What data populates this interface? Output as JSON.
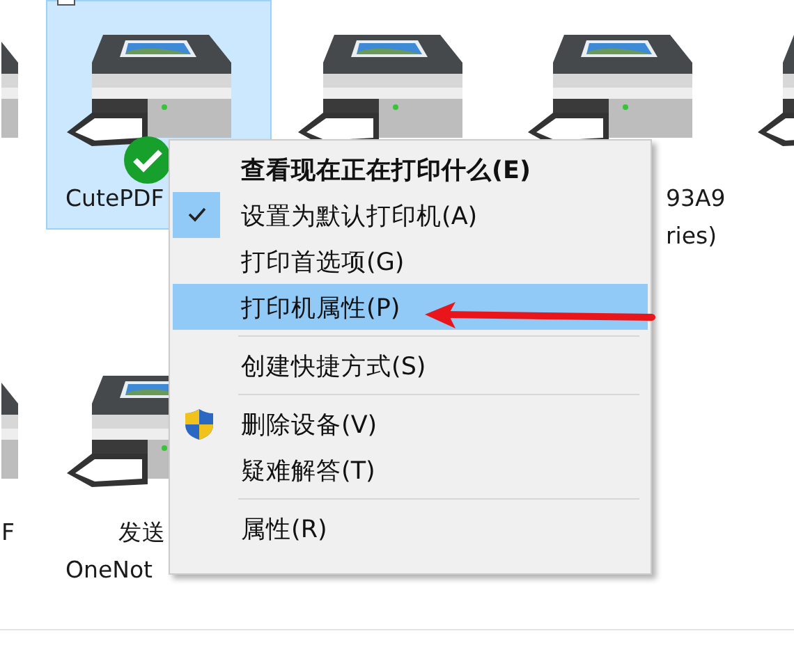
{
  "devices": [
    {
      "selected": false
    },
    {
      "labels": [
        "CutePDF"
      ],
      "selected": true,
      "default": true,
      "checkbox": {
        "checked": false
      }
    },
    {
      "selected": false,
      "default": false
    },
    {
      "labels": [
        "93A9",
        "ries)"
      ],
      "selected": false,
      "default": false
    },
    {
      "selected": false
    },
    {
      "labels": [
        "F"
      ],
      "selected": false
    },
    {
      "labels": [
        "发送",
        "OneNot"
      ],
      "selected": false,
      "default": false
    }
  ],
  "context_menu": {
    "items": [
      {
        "kind": "item",
        "label": "查看现在正在打印什么(E)",
        "default": true,
        "checked": false,
        "selected": false,
        "elevated": false
      },
      {
        "kind": "item",
        "label": "设置为默认打印机(A)",
        "default": false,
        "checked": true,
        "selected": false,
        "elevated": false
      },
      {
        "kind": "item",
        "label": "打印首选项(G)",
        "default": false,
        "checked": false,
        "selected": false,
        "elevated": false
      },
      {
        "kind": "item",
        "label": "打印机属性(P)",
        "default": false,
        "checked": false,
        "selected": true,
        "elevated": false
      },
      {
        "kind": "separator"
      },
      {
        "kind": "item",
        "label": "创建快捷方式(S)",
        "default": false,
        "checked": false,
        "selected": false,
        "elevated": false
      },
      {
        "kind": "separator"
      },
      {
        "kind": "item",
        "label": "删除设备(V)",
        "default": false,
        "checked": false,
        "selected": false,
        "elevated": true
      },
      {
        "kind": "item",
        "label": "疑难解答(T)",
        "default": false,
        "checked": false,
        "selected": false,
        "elevated": false
      },
      {
        "kind": "separator"
      },
      {
        "kind": "item",
        "label": "属性(R)",
        "default": false,
        "checked": false,
        "selected": false,
        "elevated": false
      }
    ]
  }
}
